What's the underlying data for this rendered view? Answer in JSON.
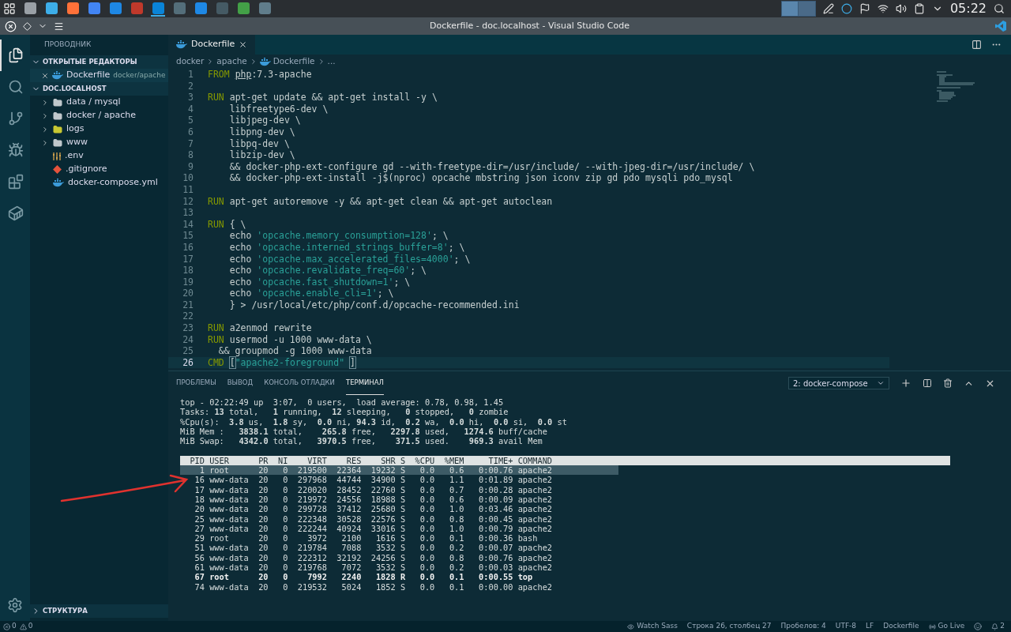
{
  "taskbar": {
    "apps": [
      {
        "selected": false
      },
      {
        "selected": false
      },
      {
        "selected": false
      },
      {
        "selected": false
      },
      {
        "selected": false
      },
      {
        "selected": false
      },
      {
        "selected": true
      },
      {
        "selected": false
      },
      {
        "selected": false
      },
      {
        "selected": false
      },
      {
        "selected": false
      },
      {
        "selected": false
      }
    ],
    "clock": "05:22"
  },
  "window": {
    "title": "Dockerfile - doc.localhost - Visual Studio Code"
  },
  "activity_bar": [
    {
      "selected": true
    },
    {
      "selected": false
    },
    {
      "selected": false
    },
    {
      "selected": false
    },
    {
      "selected": false
    },
    {
      "selected": false
    }
  ],
  "sidebar": {
    "title": "ПРОВОДНИК",
    "open_editors": {
      "title": "ОТКРЫТЫЕ РЕДАКТОРЫ",
      "expanded": true,
      "items": [
        {
          "name": "Dockerfile",
          "path": "docker/apache",
          "selected": true
        }
      ]
    },
    "folder": {
      "title": "DOC.LOCALHOST",
      "expanded": true,
      "items": [
        {
          "kind": "folder",
          "name": "data / mysql",
          "expanded": false
        },
        {
          "kind": "folder",
          "name": "docker / apache",
          "expanded": false
        },
        {
          "kind": "logs",
          "name": "logs",
          "expanded": false
        },
        {
          "kind": "folder",
          "name": "www",
          "expanded": false
        },
        {
          "kind": "env",
          "name": ".env"
        },
        {
          "kind": "git",
          "name": ".gitignore"
        },
        {
          "kind": "docker",
          "name": "docker-compose.yml"
        }
      ]
    },
    "outline": {
      "title": "СТРУКТУРА",
      "expanded": false
    }
  },
  "tabs": [
    {
      "label": "Dockerfile",
      "selected": true
    }
  ],
  "breadcrumb": [
    "docker",
    "apache",
    "Dockerfile",
    "..."
  ],
  "code": [
    {
      "number": "1",
      "current": false,
      "segments": [
        {
          "kind": "keyword",
          "text": "FROM"
        },
        {
          "kind": "underline",
          "text": "php"
        },
        {
          "kind": "plain",
          "text": ":7.3-apache"
        }
      ]
    },
    {
      "number": "2",
      "current": false
    },
    {
      "number": "3",
      "current": false,
      "segments": [
        {
          "kind": "keyword",
          "text": "RUN"
        },
        {
          "kind": "plain",
          "text": " apt-get update && apt-get install -y \\"
        }
      ]
    },
    {
      "number": "4",
      "current": false,
      "segments": [
        {
          "kind": "plain",
          "text": "    libfreetype6-dev \\"
        }
      ]
    },
    {
      "number": "5",
      "current": false,
      "segments": [
        {
          "kind": "plain",
          "text": "    libjpeg-dev \\"
        }
      ]
    },
    {
      "number": "6",
      "current": false,
      "segments": [
        {
          "kind": "plain",
          "text": "    libpng-dev \\"
        }
      ]
    },
    {
      "number": "7",
      "current": false,
      "segments": [
        {
          "kind": "plain",
          "text": "    libpq-dev \\"
        }
      ]
    },
    {
      "number": "8",
      "current": false,
      "segments": [
        {
          "kind": "plain",
          "text": "    libzip-dev \\"
        }
      ]
    },
    {
      "number": "9",
      "current": false,
      "segments": [
        {
          "kind": "plain",
          "text": "    && docker-php-ext-configure gd --with-freetype-dir=/usr/include/ --with-jpeg-dir=/usr/include/ \\"
        }
      ]
    },
    {
      "number": "10",
      "current": false,
      "segments": [
        {
          "kind": "plain",
          "text": "    && docker-php-ext-install -j$(nproc) opcache mbstring json iconv zip gd pdo mysqli pdo_mysql"
        }
      ]
    },
    {
      "number": "11",
      "current": false
    },
    {
      "number": "12",
      "current": false,
      "segments": [
        {
          "kind": "keyword",
          "text": "RUN"
        },
        {
          "kind": "plain",
          "text": " apt-get autoremove -y && apt-get clean && apt-get autoclean"
        }
      ]
    },
    {
      "number": "13",
      "current": false
    },
    {
      "number": "14",
      "current": false,
      "segments": [
        {
          "kind": "keyword",
          "text": "RUN"
        },
        {
          "kind": "plain",
          "text": " { \\"
        }
      ]
    },
    {
      "number": "15",
      "current": false,
      "segments": [
        {
          "kind": "plain",
          "text": "    echo "
        },
        {
          "kind": "string",
          "text": "'opcache.memory_consumption=128'"
        },
        {
          "kind": "plain",
          "text": "; \\"
        }
      ]
    },
    {
      "number": "16",
      "current": false,
      "segments": [
        {
          "kind": "plain",
          "text": "    echo "
        },
        {
          "kind": "string",
          "text": "'opcache.interned_strings_buffer=8'"
        },
        {
          "kind": "plain",
          "text": "; \\"
        }
      ]
    },
    {
      "number": "17",
      "current": false,
      "segments": [
        {
          "kind": "plain",
          "text": "    echo "
        },
        {
          "kind": "string",
          "text": "'opcache.max_accelerated_files=4000'"
        },
        {
          "kind": "plain",
          "text": "; \\"
        }
      ]
    },
    {
      "number": "18",
      "current": false,
      "segments": [
        {
          "kind": "plain",
          "text": "    echo "
        },
        {
          "kind": "string",
          "text": "'opcache.revalidate_freq=60'"
        },
        {
          "kind": "plain",
          "text": "; \\"
        }
      ]
    },
    {
      "number": "19",
      "current": false,
      "segments": [
        {
          "kind": "plain",
          "text": "    echo "
        },
        {
          "kind": "string",
          "text": "'opcache.fast_shutdown=1'"
        },
        {
          "kind": "plain",
          "text": "; \\"
        }
      ]
    },
    {
      "number": "20",
      "current": false,
      "segments": [
        {
          "kind": "plain",
          "text": "    echo "
        },
        {
          "kind": "string",
          "text": "'opcache.enable_cli=1'"
        },
        {
          "kind": "plain",
          "text": "; \\"
        }
      ]
    },
    {
      "number": "21",
      "current": false,
      "segments": [
        {
          "kind": "plain",
          "text": "    } > /usr/local/etc/php/conf.d/opcache-recommended.ini"
        }
      ]
    },
    {
      "number": "22",
      "current": false
    },
    {
      "number": "23",
      "current": false,
      "segments": [
        {
          "kind": "keyword",
          "text": "RUN"
        },
        {
          "kind": "plain",
          "text": " a2enmod rewrite"
        }
      ]
    },
    {
      "number": "24",
      "current": false,
      "segments": [
        {
          "kind": "keyword",
          "text": "RUN"
        },
        {
          "kind": "plain",
          "text": " usermod -u 1000 www-data \\"
        }
      ]
    },
    {
      "number": "25",
      "current": false,
      "segments": [
        {
          "kind": "plain",
          "text": "  && groupmod -g 1000 www-data"
        }
      ]
    },
    {
      "number": "26",
      "current": true,
      "segments": [
        {
          "kind": "keyword",
          "text": "CMD"
        },
        {
          "kind": "bracket",
          "text": "["
        },
        {
          "kind": "string",
          "text": "\"apache2-foreground\""
        },
        {
          "kind": "bracket",
          "text": "]"
        }
      ]
    }
  ],
  "panel": {
    "tabs": [
      {
        "label": "ПРОБЛЕМЫ",
        "selected": false
      },
      {
        "label": "ВЫВОД",
        "selected": false
      },
      {
        "label": "КОНСОЛЬ ОТЛАДКИ",
        "selected": false
      },
      {
        "label": "ТЕРМИНАЛ",
        "selected": true
      }
    ],
    "terminal_select": "2: docker-compose"
  },
  "terminal": {
    "summary": [
      "top - 02:22:49 up  3:07,  0 users,  load average: 0.78, 0.98, 1.45",
      "Tasks: **13** total,   **1** running,  **12** sleeping,   **0** stopped,   **0** zombie",
      "%Cpu(s):  **3.8** us,  **1.8** sy,  **0.0** ni, **94.3** id,  **0.2** wa,  **0.0** hi,  **0.0** si,  **0.0** st",
      "MiB Mem :   **3838.1** total,    **265.8** free,   **2297.8** used,   **1274.6** buff/cache",
      "MiB Swap:   **4342.0** total,   **3970.5** free,    **371.5** used.    **969.3** avail Mem"
    ],
    "columns": [
      "PID",
      "USER",
      "PR",
      "NI",
      "VIRT",
      "RES",
      "SHR",
      "S",
      "%CPU",
      "%MEM",
      "TIME+",
      "COMMAND"
    ],
    "rows": [
      {
        "selected": true,
        "running": false,
        "cells": [
          "1",
          "root",
          "20",
          "0",
          "219500",
          "22364",
          "19232",
          "S",
          "0.0",
          "0.6",
          "0:00.76",
          "apache2"
        ]
      },
      {
        "selected": false,
        "running": false,
        "cells": [
          "16",
          "www-data",
          "20",
          "0",
          "297968",
          "44744",
          "34900",
          "S",
          "0.0",
          "1.1",
          "0:01.89",
          "apache2"
        ]
      },
      {
        "selected": false,
        "running": false,
        "cells": [
          "17",
          "www-data",
          "20",
          "0",
          "220020",
          "28452",
          "22760",
          "S",
          "0.0",
          "0.7",
          "0:00.28",
          "apache2"
        ]
      },
      {
        "selected": false,
        "running": false,
        "cells": [
          "18",
          "www-data",
          "20",
          "0",
          "219972",
          "24556",
          "18988",
          "S",
          "0.0",
          "0.6",
          "0:00.09",
          "apache2"
        ]
      },
      {
        "selected": false,
        "running": false,
        "cells": [
          "20",
          "www-data",
          "20",
          "0",
          "299728",
          "37412",
          "25680",
          "S",
          "0.0",
          "1.0",
          "0:03.46",
          "apache2"
        ]
      },
      {
        "selected": false,
        "running": false,
        "cells": [
          "25",
          "www-data",
          "20",
          "0",
          "222348",
          "30528",
          "22576",
          "S",
          "0.0",
          "0.8",
          "0:00.45",
          "apache2"
        ]
      },
      {
        "selected": false,
        "running": false,
        "cells": [
          "27",
          "www-data",
          "20",
          "0",
          "222244",
          "40924",
          "33016",
          "S",
          "0.0",
          "1.0",
          "0:00.79",
          "apache2"
        ]
      },
      {
        "selected": false,
        "running": false,
        "cells": [
          "29",
          "root",
          "20",
          "0",
          "3972",
          "2100",
          "1616",
          "S",
          "0.0",
          "0.1",
          "0:00.36",
          "bash"
        ]
      },
      {
        "selected": false,
        "running": false,
        "cells": [
          "51",
          "www-data",
          "20",
          "0",
          "219784",
          "7088",
          "3532",
          "S",
          "0.0",
          "0.2",
          "0:00.07",
          "apache2"
        ]
      },
      {
        "selected": false,
        "running": false,
        "cells": [
          "56",
          "www-data",
          "20",
          "0",
          "222312",
          "32192",
          "24256",
          "S",
          "0.0",
          "0.8",
          "0:00.76",
          "apache2"
        ]
      },
      {
        "selected": false,
        "running": false,
        "cells": [
          "61",
          "www-data",
          "20",
          "0",
          "219768",
          "7072",
          "3532",
          "S",
          "0.0",
          "0.2",
          "0:00.03",
          "apache2"
        ]
      },
      {
        "selected": false,
        "running": true,
        "cells": [
          "67",
          "root",
          "20",
          "0",
          "7992",
          "2240",
          "1828",
          "R",
          "0.0",
          "0.1",
          "0:00.55",
          "top"
        ]
      },
      {
        "selected": false,
        "running": false,
        "cells": [
          "74",
          "www-data",
          "20",
          "0",
          "219532",
          "5024",
          "1852",
          "S",
          "0.0",
          "0.1",
          "0:00.00",
          "apache2"
        ]
      }
    ]
  },
  "status_bar": {
    "errors": "0",
    "warnings": "0",
    "watch_sass": "Watch Sass",
    "position": "Строка 26, столбец 27",
    "indent": "Пробелов: 4",
    "encoding": "UTF-8",
    "eol": "LF",
    "language": "Dockerfile",
    "go_live": "Go Live",
    "notifications": "2"
  }
}
